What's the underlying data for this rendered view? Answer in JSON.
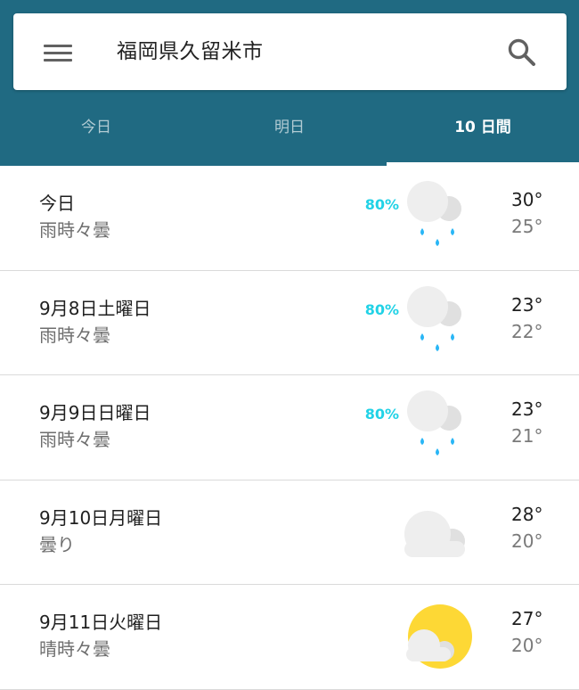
{
  "search": {
    "location": "福岡県久留米市"
  },
  "tabs": [
    {
      "label": "今日",
      "active": false
    },
    {
      "label": "明日",
      "active": false
    },
    {
      "label": "10 日間",
      "active": true
    }
  ],
  "colors": {
    "header": "#206a82",
    "precip": "#21d2e6",
    "rain_drop": "#29b6f6",
    "sun": "#fdd835",
    "cloud": "#eeeeee"
  },
  "forecast": [
    {
      "date": "今日",
      "condition": "雨時々曇",
      "precip": "80%",
      "icon": "rain-cloud-icon",
      "high": "30°",
      "low": "25°"
    },
    {
      "date": "9月8日土曜日",
      "condition": "雨時々曇",
      "precip": "80%",
      "icon": "rain-cloud-icon",
      "high": "23°",
      "low": "22°"
    },
    {
      "date": "9月9日日曜日",
      "condition": "雨時々曇",
      "precip": "80%",
      "icon": "rain-cloud-icon",
      "high": "23°",
      "low": "21°"
    },
    {
      "date": "9月10日月曜日",
      "condition": "曇り",
      "precip": "",
      "icon": "cloud-icon",
      "high": "28°",
      "low": "20°"
    },
    {
      "date": "9月11日火曜日",
      "condition": "晴時々曇",
      "precip": "",
      "icon": "sun-cloud-icon",
      "high": "27°",
      "low": "20°"
    }
  ]
}
